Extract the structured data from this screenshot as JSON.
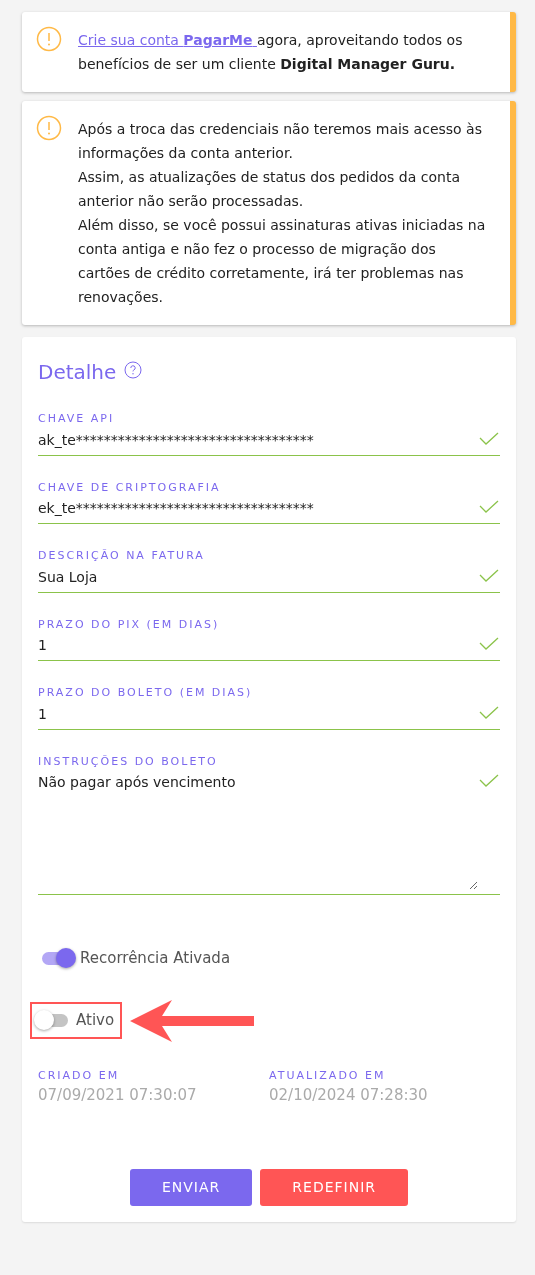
{
  "alerts": [
    {
      "link": "Crie sua conta **PagarMe** ",
      "text": "agora, aproveitando todos os benefícios de ser um cliente **Digital Manager Guru.**"
    },
    {
      "lines": [
        "Após a troca das credenciais não teremos mais acesso às informações da conta anterior.",
        "Assim, as atualizações de status dos pedidos da conta anterior não serão processadas.",
        "Além disso, se você possui assinaturas ativas iniciadas na conta antiga e não fez o processo de migração dos cartões de crédito corretamente, irá ter problemas nas renovações."
      ]
    }
  ],
  "detail": {
    "title": "Detalhe",
    "fields": [
      {
        "kind": "input",
        "label": "CHAVE API",
        "value": "ak_te**********************************",
        "valid": true
      },
      {
        "kind": "input",
        "label": "CHAVE DE CRIPTOGRAFIA",
        "value": "ek_te**********************************",
        "valid": true
      },
      {
        "kind": "input",
        "label": "DESCRIÇÃO NA FATURA",
        "value": "Sua Loja",
        "valid": true
      },
      {
        "kind": "input",
        "label": "PRAZO DO PIX (EM DIAS)",
        "value": "1",
        "valid": true
      },
      {
        "kind": "input",
        "label": "PRAZO DO BOLETO (EM DIAS)",
        "value": "1",
        "valid": true
      },
      {
        "kind": "textarea",
        "label": "INSTRUÇÕES DO BOLETO",
        "value": "Não pagar após vencimento",
        "valid": true
      }
    ],
    "toggles": [
      {
        "label": "Recorrência Ativada",
        "on": true,
        "highlighted": false
      },
      {
        "label": "Ativo",
        "on": false,
        "highlighted": true
      }
    ],
    "dates": [
      {
        "label": "CRIADO EM",
        "value": "07/09/2021 07:30:07"
      },
      {
        "label": "ATUALIZADO EM",
        "value": "02/10/2024 07:28:30"
      }
    ],
    "buttons": [
      {
        "label": "ENVIAR",
        "kind": "primary"
      },
      {
        "label": "REDEFINIR",
        "kind": "danger"
      }
    ]
  }
}
